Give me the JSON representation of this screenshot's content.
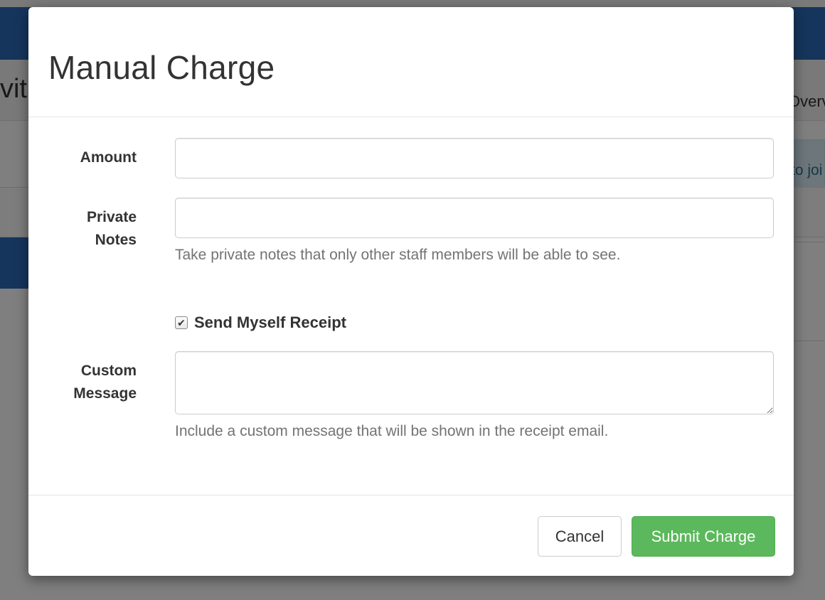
{
  "background": {
    "header_left_text": "vith",
    "header_right_text": "Overv",
    "alert_text": "to joi"
  },
  "modal": {
    "title": "Manual Charge",
    "fields": {
      "amount": {
        "label": "Amount",
        "value": "",
        "placeholder": ""
      },
      "private_notes": {
        "label_line1": "Private",
        "label_line2": "Notes",
        "value": "",
        "help": "Take private notes that only other staff members will be able to see."
      },
      "send_receipt": {
        "label": "Send Myself Receipt",
        "checked": true,
        "check_glyph": "✔"
      },
      "custom_message": {
        "label_line1": "Custom",
        "label_line2": "Message",
        "value": "",
        "help": "Include a custom message that will be shown in the receipt email."
      }
    },
    "footer": {
      "cancel_label": "Cancel",
      "submit_label": "Submit Charge"
    }
  },
  "colors": {
    "navbar": "#2d6ab8",
    "success": "#5cb85c",
    "help_text": "#737373"
  }
}
